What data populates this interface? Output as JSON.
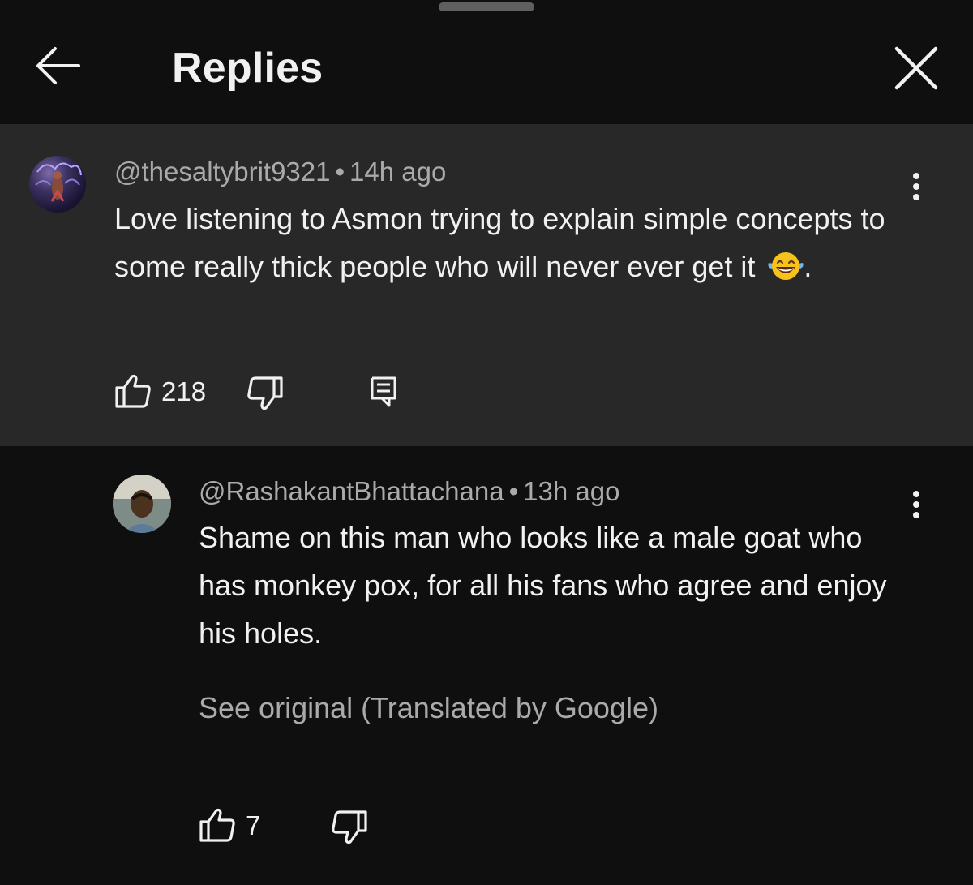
{
  "header": {
    "title": "Replies"
  },
  "icons": {
    "back": "arrow-left-icon",
    "close": "close-icon",
    "more": "more-vert-icon",
    "like": "thumb-up-icon",
    "dislike": "thumb-down-icon",
    "reply": "comment-reply-icon",
    "emoji": "face-with-tears-of-joy-icon"
  },
  "parent_comment": {
    "username": "@thesaltybrit9321",
    "separator": "•",
    "timestamp": "14h ago",
    "text": "Love listening to Asmon trying to explain simple concepts to some really thick people who will never ever get it",
    "text_suffix": ".",
    "likes": "218"
  },
  "reply": {
    "username": "@RashakantBhattachana",
    "separator": "•",
    "timestamp": "13h ago",
    "text": "Shame on this man who looks like a male goat who has monkey pox, for all his fans who agree and enjoy his holes.",
    "see_original": "See original (Translated by Google)",
    "likes": "7"
  },
  "colors": {
    "background": "#0f0f0f",
    "parent_highlight": "#282828",
    "text_primary": "#f1f1f1",
    "text_secondary": "#aaaaaa"
  }
}
